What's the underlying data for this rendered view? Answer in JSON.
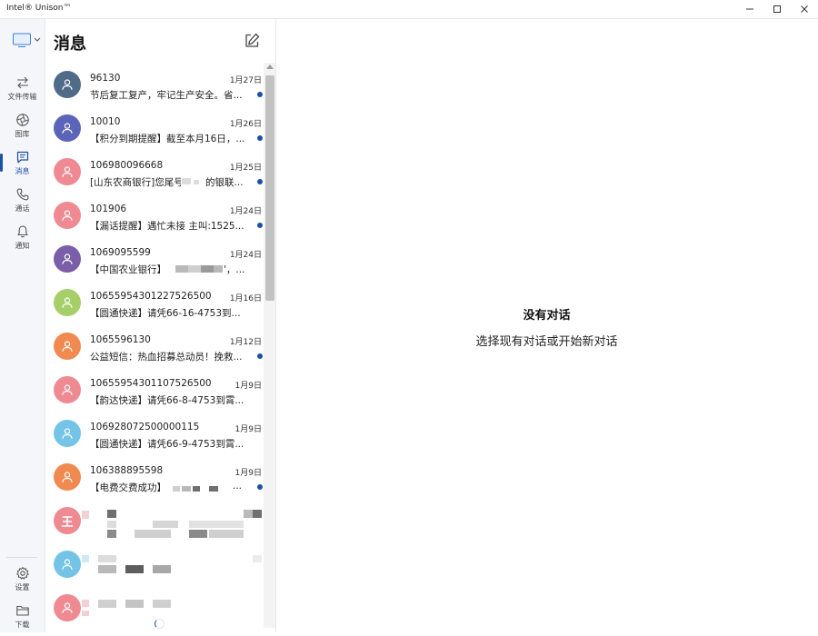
{
  "window": {
    "title": "Intel® Unison™",
    "controls": [
      "minimize-icon",
      "maximize-icon",
      "close-icon"
    ]
  },
  "rail": {
    "device_icon": "monitor-icon",
    "items": [
      {
        "label": "文件传输",
        "icon": "transfer-icon",
        "active": false
      },
      {
        "label": "图库",
        "icon": "gallery-icon",
        "active": false
      },
      {
        "label": "消息",
        "icon": "message-icon",
        "active": true
      },
      {
        "label": "通话",
        "icon": "phone-icon",
        "active": false
      },
      {
        "label": "通知",
        "icon": "bell-icon",
        "active": false
      }
    ],
    "bottom_items": [
      {
        "label": "设置",
        "icon": "gear-icon"
      },
      {
        "label": "下载",
        "icon": "folder-icon"
      }
    ]
  },
  "messages": {
    "title": "消息",
    "compose_icon": "compose-icon",
    "conversations": [
      {
        "sender": "96130",
        "date": "1月27日",
        "snippet": "节后复工复产，牢记生产安全。省...",
        "avatar_color": "#4f6b88",
        "unread": true
      },
      {
        "sender": "10010",
        "date": "1月26日",
        "snippet": "【积分到期提醒】截至本月16日，...",
        "avatar_color": "#5b64b8",
        "unread": true
      },
      {
        "sender": "106980096668",
        "date": "1月25日",
        "snippet": "[山东农商银行]您尾号",
        "snippet_tail": "的银联...",
        "avatar_color": "#ef8a92",
        "unread": true
      },
      {
        "sender": "101906",
        "date": "1月24日",
        "snippet": "【漏话提醒】遇忙未接 主叫:1525...",
        "avatar_color": "#ef8a92",
        "unread": true
      },
      {
        "sender": "1069095599",
        "date": "1月24日",
        "snippet": "【中国农业银行】",
        "snippet_tail": "'，...",
        "avatar_color": "#7a5fa8",
        "unread": false
      },
      {
        "sender": "10655954301227526500",
        "date": "1月16日",
        "snippet": "【圆通快递】请凭66-16-4753到...",
        "avatar_color": "#a6cf6a",
        "unread": false
      },
      {
        "sender": "1065596130",
        "date": "1月12日",
        "snippet": "公益短信：热血招募总动员！挽救...",
        "avatar_color": "#f08a50",
        "unread": true
      },
      {
        "sender": "10655954301107526500",
        "date": "1月9日",
        "snippet": "【韵达快递】请凭66-8-4753到霄...",
        "avatar_color": "#ef8a92",
        "unread": false
      },
      {
        "sender": "106928072500000115",
        "date": "1月9日",
        "snippet": "【圆通快递】请凭66-9-4753到霄...",
        "avatar_color": "#74c4e8",
        "unread": false
      },
      {
        "sender": "106388895598",
        "date": "1月9日",
        "snippet": "【电费交费成功】",
        "snippet_tail": "...",
        "avatar_color": "#f08a50",
        "unread": true
      },
      {
        "sender": "",
        "date": "",
        "snippet": "",
        "avatar_letter": "王",
        "avatar_color": "#ef8a92",
        "unread": false
      },
      {
        "sender": "",
        "date": "",
        "snippet": "",
        "avatar_color": "#74c4e8",
        "unread": false
      },
      {
        "sender": "",
        "date": "",
        "snippet": "",
        "avatar_color": "#ef8a92",
        "unread": false
      }
    ]
  },
  "empty_state": {
    "title": "没有对话",
    "subtitle": "选择现有对话或开始新对话"
  },
  "colors": {
    "accent": "#1e4fa8",
    "rail_bg": "#f4f6f9"
  }
}
